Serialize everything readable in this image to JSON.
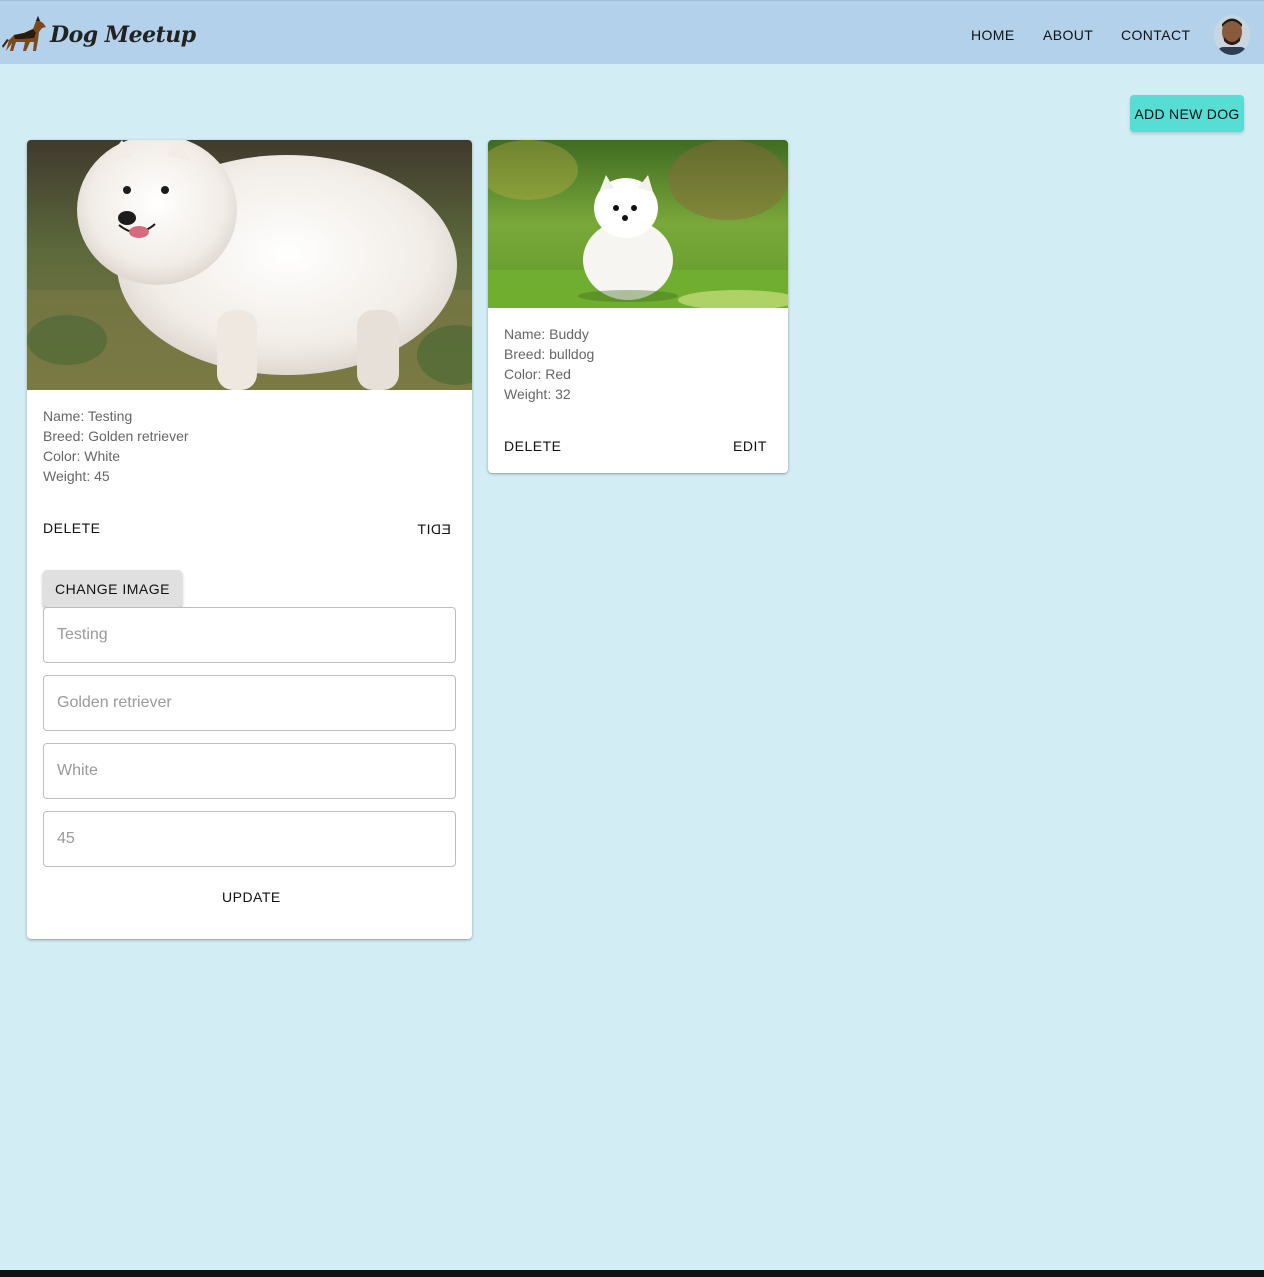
{
  "app": {
    "brand_name": "Dog Meetup",
    "logo_icon": "german-shepherd-dog-icon",
    "avatar_icon": "user-avatar-photo"
  },
  "nav": {
    "home": "HOME",
    "about": "ABOUT",
    "contact": "CONTACT"
  },
  "actions": {
    "add_new_dog": "ADD NEW DOG"
  },
  "colors": {
    "navbar": "#b3d1ea",
    "page_background": "#d2eef4",
    "add_button": "#56ddd4"
  },
  "dogs": [
    {
      "image_desc": "white-samoyed-photo",
      "name_line": "Name: Testing",
      "breed_line": "Breed: Golden retriever",
      "color_line": "Color: White",
      "weight_line": "Weight: 45",
      "delete_label": "DELETE",
      "edit_label": "EDIT",
      "edit_form": {
        "change_image_label": "CHANGE IMAGE",
        "name_placeholder": "Testing",
        "breed_placeholder": "Golden retriever",
        "color_placeholder": "White",
        "weight_placeholder": "45",
        "update_label": "UPDATE"
      }
    },
    {
      "image_desc": "white-pomeranian-puppy-photo",
      "name_line": "Name: Buddy",
      "breed_line": "Breed: bulldog",
      "color_line": "Color: Red",
      "weight_line": "Weight: 32",
      "delete_label": "DELETE",
      "edit_label": "EDIT"
    }
  ]
}
